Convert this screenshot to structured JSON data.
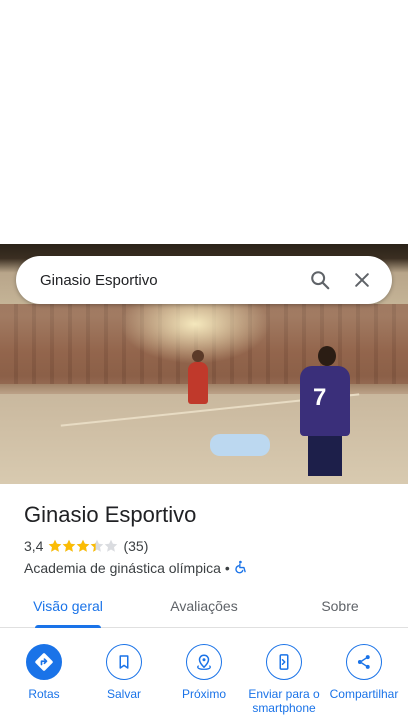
{
  "search": {
    "query": "Ginasio Esportivo"
  },
  "place": {
    "title": "Ginasio Esportivo",
    "rating": "3,4",
    "rating_value": 3.4,
    "review_count": "(35)",
    "category": "Academia de ginástica olímpica",
    "separator": "•",
    "accessibility_icon": "wheelchair-icon"
  },
  "tabs": [
    {
      "label": "Visão geral",
      "active": true
    },
    {
      "label": "Avaliações",
      "active": false
    },
    {
      "label": "Sobre",
      "active": false
    }
  ],
  "actions": [
    {
      "label": "Rotas",
      "icon": "directions-icon"
    },
    {
      "label": "Salvar",
      "icon": "bookmark-icon"
    },
    {
      "label": "Próximo",
      "icon": "nearby-icon"
    },
    {
      "label": "Enviar para o smartphone",
      "icon": "send-to-phone-icon"
    },
    {
      "label": "Compartilhar",
      "icon": "share-icon"
    }
  ],
  "colors": {
    "accent": "#1a73e8",
    "star": "#fbbc04",
    "text": "#202124",
    "secondary": "#5f6368"
  },
  "hero_photo_jersey_number": "7"
}
